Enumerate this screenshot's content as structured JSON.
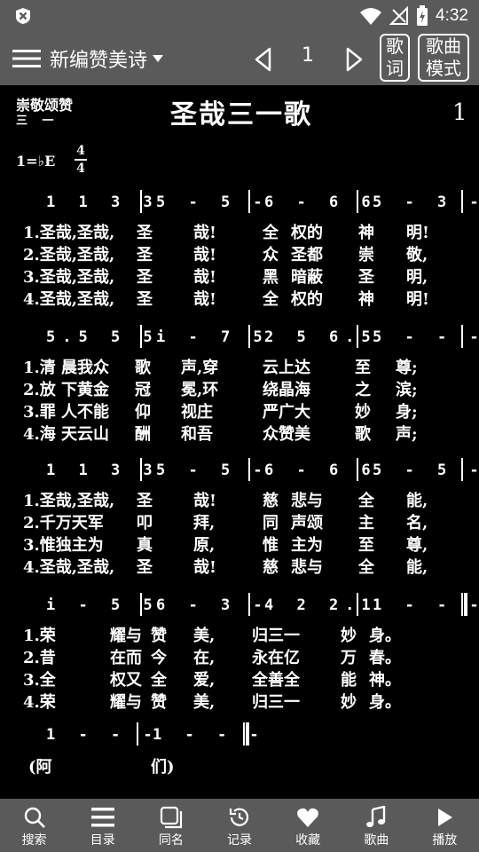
{
  "status_bar": {
    "time": "4:32",
    "icons": [
      "app-close-badge-icon",
      "wifi-icon",
      "signal-off-icon",
      "battery-charging-icon"
    ]
  },
  "toolbar": {
    "menu_icon": "hamburger-menu-icon",
    "book_title": "新编赞美诗",
    "page_number": "1",
    "lyrics_button": "歌词",
    "mode_button": "歌曲模式"
  },
  "score": {
    "category": "崇敬颂赞",
    "category_sub": "三 一",
    "title": "圣哉三一歌",
    "hymn_number": "1",
    "key": "1=♭E",
    "time_signature": {
      "top": "4",
      "bottom": "4"
    },
    "systems": [
      {
        "measures": [
          "1 1 3 3",
          "5 - 5 -",
          "6 - 6 6",
          "5 - 3 -"
        ],
        "verses": [
          [
            "1.圣哉,圣哉,",
            "圣",
            "哉!",
            "全",
            "权的",
            "神",
            "明!"
          ],
          [
            "2.圣哉,圣哉,",
            "圣",
            "哉!",
            "众",
            "圣都",
            "崇",
            "敬,"
          ],
          [
            "3.圣哉,圣哉,",
            "圣",
            "哉!",
            "黑",
            "暗蔽",
            "圣",
            "明,"
          ],
          [
            "4.圣哉,圣哉,",
            "圣",
            "哉!",
            "全",
            "权的",
            "神",
            "明!"
          ]
        ]
      },
      {
        "measures": [
          "5.5 5 5",
          "i - 7 5",
          "2 5 6.5",
          "5 - - -"
        ],
        "verses": [
          [
            "1.清 晨我众",
            "歌",
            "声,穿",
            "云上达",
            "至",
            "尊;",
            ""
          ],
          [
            "2.放 下黄金",
            "冠",
            "冕,环",
            "绕晶海",
            "之",
            "滨;",
            ""
          ],
          [
            "3.罪 人不能",
            "仰",
            "视庄",
            "严广大",
            "妙",
            "身;",
            ""
          ],
          [
            "4.海 天云山",
            "酬",
            "和吾",
            "众赞美",
            "歌",
            "声;",
            ""
          ]
        ]
      },
      {
        "measures": [
          "1 1 3 3",
          "5 - 5 -",
          "6 - 6 6",
          "5 - 5 -"
        ],
        "verses": [
          [
            "1.圣哉,圣哉,",
            "圣",
            "哉!",
            "慈",
            "悲与",
            "全",
            "能,"
          ],
          [
            "2.千万天军",
            "叩",
            "拜,",
            "同",
            "声颂",
            "主",
            "名,"
          ],
          [
            "3.惟独主为",
            "真",
            "原,",
            "惟",
            "主为",
            "至",
            "尊,"
          ],
          [
            "4.圣哉,圣哉,",
            "圣",
            "哉!",
            "慈",
            "悲与",
            "全",
            "能,"
          ]
        ]
      },
      {
        "measures": [
          "i - 5 5",
          "6 - 3 -",
          "4 2 2.1",
          "1 - - -"
        ],
        "verses": [
          [
            "1.荣",
            "耀与",
            "赞",
            "美,",
            "归三一",
            "妙",
            "身。"
          ],
          [
            "2.昔",
            "在而",
            "今",
            "在,",
            "永在亿",
            "万",
            "春。"
          ],
          [
            "3.全",
            "权又",
            "全",
            "爱,",
            "全善全",
            "能",
            "神。"
          ],
          [
            "4.荣",
            "耀与",
            "赞",
            "美,",
            "归三一",
            "妙",
            "身。"
          ]
        ]
      }
    ],
    "amen": {
      "measures": [
        "1 - - -",
        "1 - - -"
      ],
      "lyrics": [
        "(阿",
        "们)"
      ]
    }
  },
  "tabbar": {
    "items": [
      {
        "label": "搜索",
        "icon": "search-icon"
      },
      {
        "label": "目录",
        "icon": "list-icon"
      },
      {
        "label": "同名",
        "icon": "copy-icon"
      },
      {
        "label": "记录",
        "icon": "history-icon"
      },
      {
        "label": "收藏",
        "icon": "heart-icon"
      },
      {
        "label": "歌曲",
        "icon": "music-note-icon"
      },
      {
        "label": "播放",
        "icon": "play-icon"
      }
    ]
  }
}
